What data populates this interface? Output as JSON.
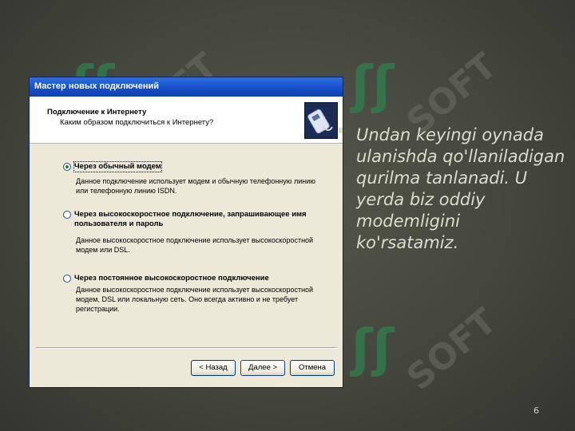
{
  "watermark": {
    "text": "SOFT",
    "symbol": "ʃʃ",
    "color": "#2f7f4d"
  },
  "dialog": {
    "title": "Мастер новых подключений",
    "header_title": "Подключение к Интернету",
    "header_subtitle": "Каким образом подключиться к Интернету?",
    "header_icon": "modem-phone-icon",
    "options": [
      {
        "label": "Через обычный модем",
        "selected": true,
        "description": "Данное подключение использует модем и обычную телефонную линию или телефонную линию ISDN."
      },
      {
        "label": "Через высокоскоростное подключение, запрашивающее имя пользователя и пароль",
        "selected": false,
        "description": "Данное высокоскоростное подключение использует высокоскоростной модем или DSL."
      },
      {
        "label": "Через постоянное высокоскоростное подключение",
        "selected": false,
        "description": "Данное высокоскоростное подключение использует высокоскоростной модем, DSL или локальную сеть. Оно всегда активно и не требует регистрации."
      }
    ],
    "buttons": {
      "back": "< Назад",
      "next": "Далее >",
      "cancel": "Отмена"
    }
  },
  "caption": "Undan keyingi oynada ulanishda qo'llaniladigan qurilma tanlanadi. U yerda biz oddiy modemligini ko'rsatamiz.",
  "page_number": "6"
}
